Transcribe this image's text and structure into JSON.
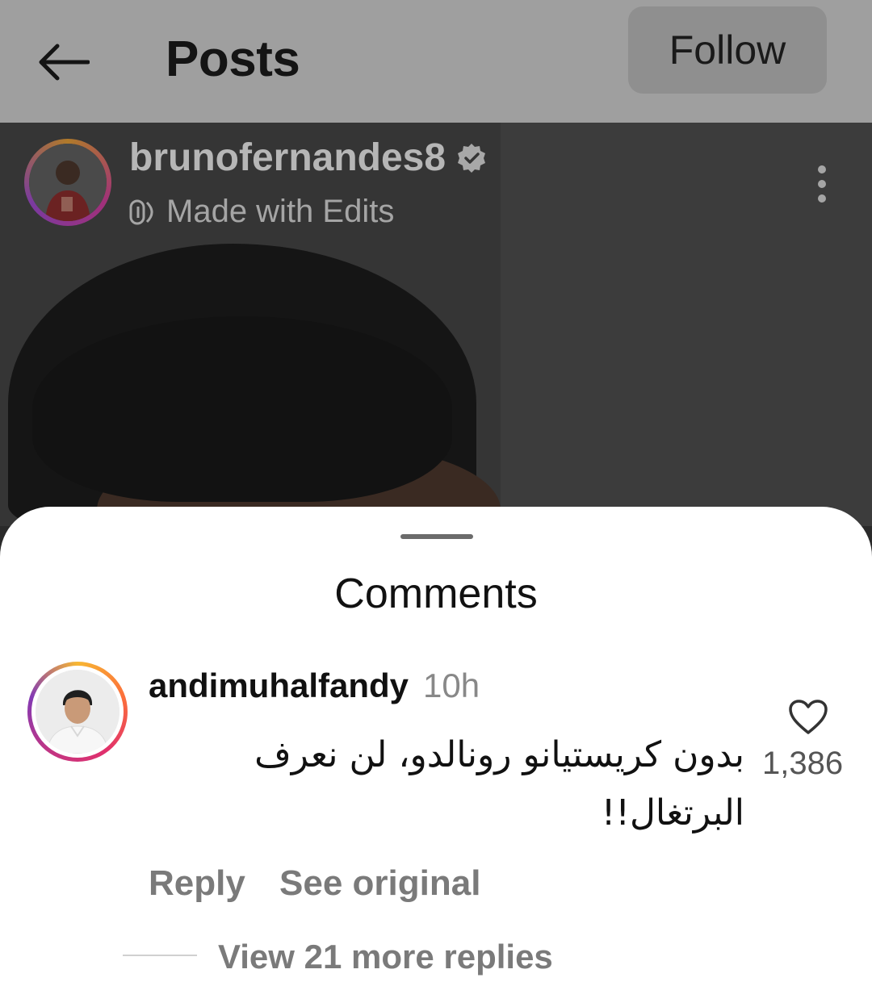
{
  "header": {
    "title": "Posts",
    "back_icon": "arrow-left-icon",
    "follow_label": "Follow"
  },
  "post": {
    "username": "brunofernandes8",
    "verified_icon": "verified-badge-icon",
    "subtitle": "Made with Edits",
    "subtitle_icon": "edits-icon",
    "more_icon": "more-vertical-icon"
  },
  "comments": {
    "title": "Comments",
    "items": [
      {
        "username": "andimuhalfandy",
        "time": "10h",
        "text": "بدون كريستيانو رونالدو، لن نعرف البرتغال!!",
        "like_count": "1,386",
        "like_icon": "heart-outline-icon",
        "reply_label": "Reply",
        "see_original_label": "See original",
        "view_replies_label": "View 21 more replies"
      }
    ]
  },
  "colors": {
    "overlay_bar": "#9f9f9f",
    "follow_button": "#8f8f8f",
    "sheet": "#ffffff",
    "muted_text": "#7a7a7a"
  }
}
